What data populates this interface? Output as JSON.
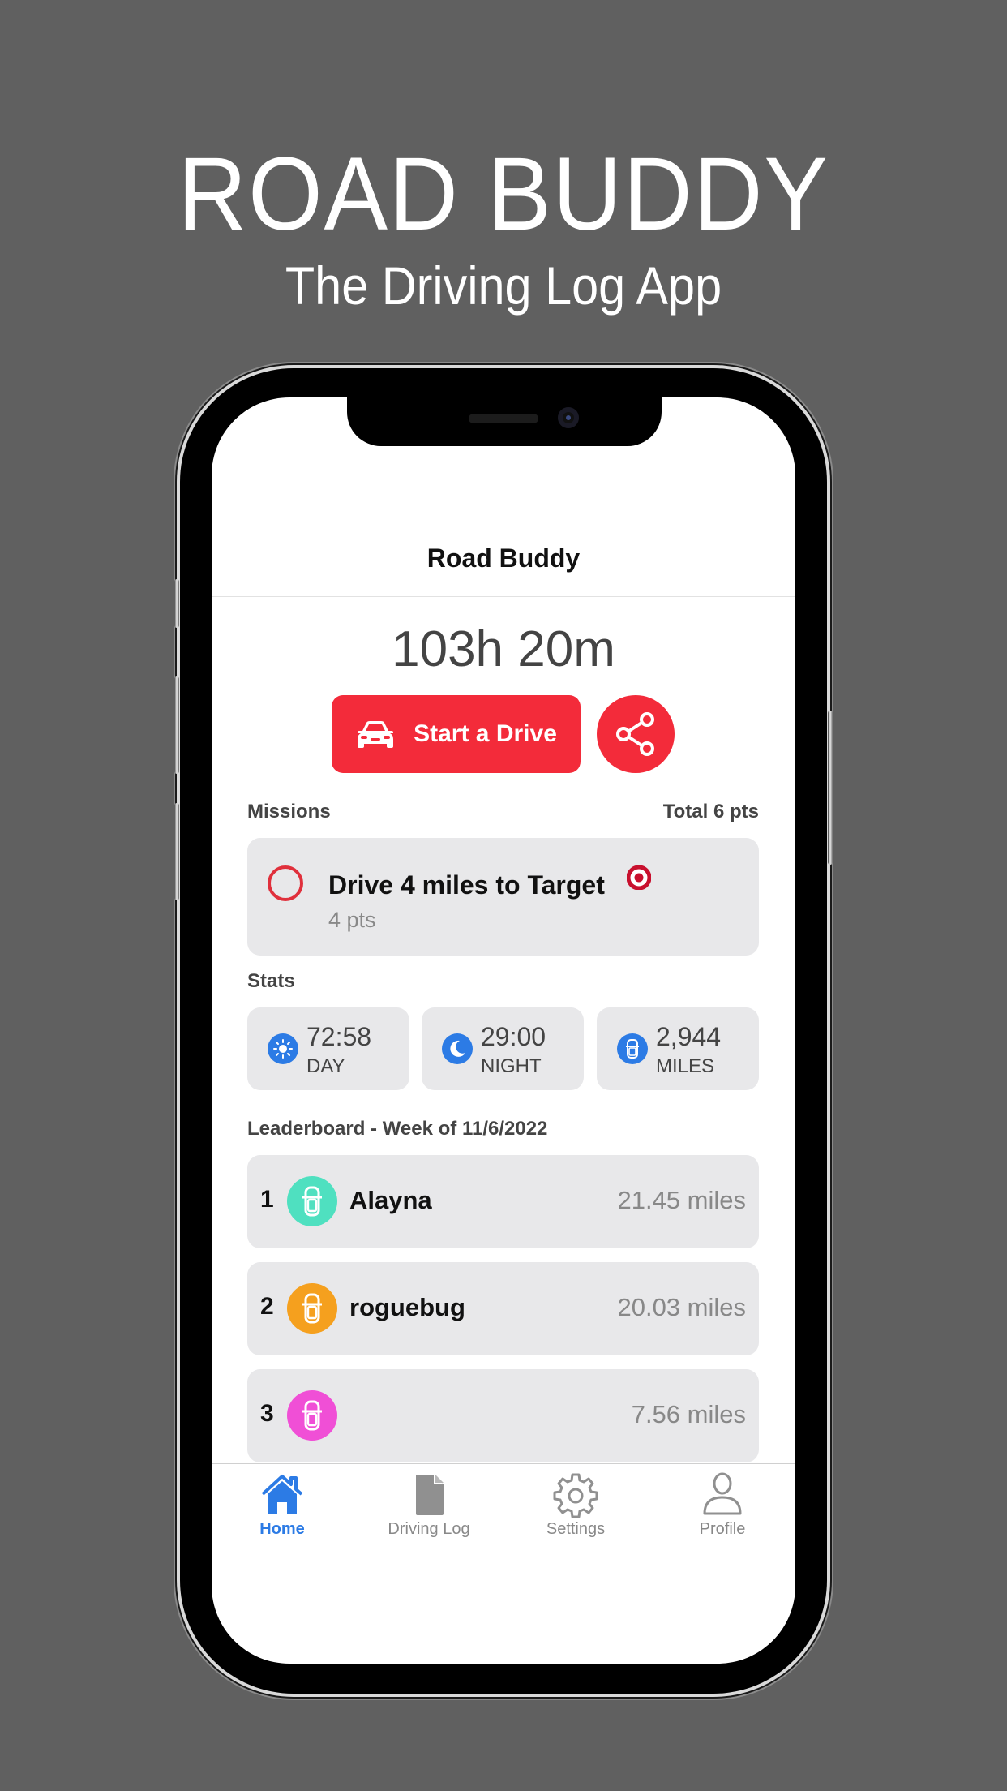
{
  "promo": {
    "title": "ROAD BUDDY",
    "subtitle": "The Driving Log App"
  },
  "app": {
    "nav_title": "Road Buddy",
    "total_time": "103h 20m",
    "start_button_label": "Start a Drive",
    "start_button_icon": "car-icon",
    "share_button_icon": "share-icon",
    "accent_color": "#f32b3a",
    "missions": {
      "label": "Missions",
      "total": "Total 6 pts",
      "items": [
        {
          "title": "Drive 4 miles to Target",
          "points": "4 pts",
          "completed": false,
          "brand_icon": "target-logo-icon"
        }
      ]
    },
    "stats": {
      "label": "Stats",
      "items": [
        {
          "value": "72:58",
          "label": "DAY",
          "icon": "sun-icon"
        },
        {
          "value": "29:00",
          "label": "NIGHT",
          "icon": "moon-icon"
        },
        {
          "value": "2,944",
          "label": "MILES",
          "icon": "car-top-icon"
        }
      ],
      "icon_color": "#2c7be5"
    },
    "leaderboard": {
      "label": "Leaderboard - Week of 11/6/2022",
      "rows": [
        {
          "rank": "1",
          "name": "Alayna",
          "miles": "21.45 miles",
          "avatar_color": "#4fe0c0"
        },
        {
          "rank": "2",
          "name": "roguebug",
          "miles": "20.03 miles",
          "avatar_color": "#f5a01e"
        },
        {
          "rank": "3",
          "name": "",
          "miles": "7.56 miles",
          "avatar_color": "#f04fd6"
        }
      ]
    },
    "tabs": [
      {
        "label": "Home",
        "icon": "home-icon",
        "active": true
      },
      {
        "label": "Driving Log",
        "icon": "document-icon",
        "active": false
      },
      {
        "label": "Settings",
        "icon": "gear-icon",
        "active": false
      },
      {
        "label": "Profile",
        "icon": "person-icon",
        "active": false
      }
    ]
  }
}
